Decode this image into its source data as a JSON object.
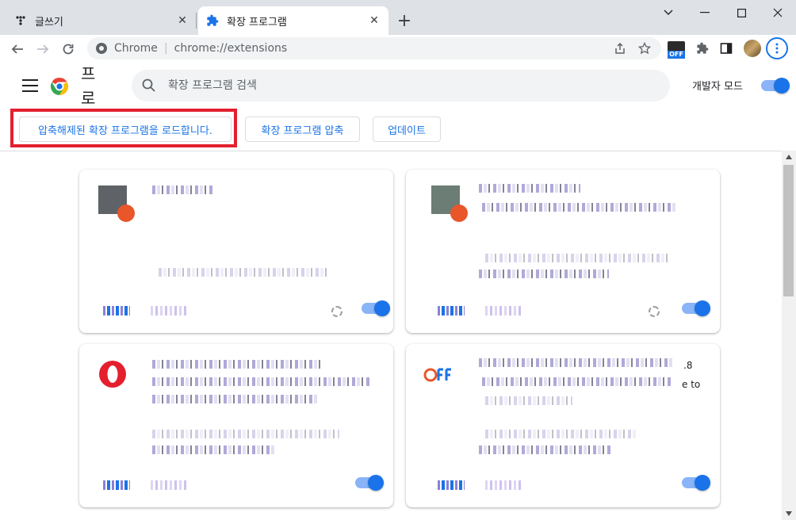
{
  "tabs": [
    {
      "label": "글쓰기",
      "icon": "writing-app-icon",
      "active": false
    },
    {
      "label": "확장 프로그램",
      "icon": "puzzle-icon",
      "active": true
    }
  ],
  "omnibox": {
    "site_label": "Chrome",
    "url": "chrome://extensions"
  },
  "extension_badge": {
    "label": "OFF"
  },
  "header": {
    "title_chars": [
      "프",
      "로"
    ],
    "search_placeholder": "확장 프로그램 검색",
    "dev_mode_label": "개발자 모드",
    "dev_mode_on": true
  },
  "actions": {
    "load_unpacked": "압축해제된 확장 프로그램을 로드합니다.",
    "pack": "확장 프로그램 압축",
    "update": "업데이트"
  },
  "cards": [
    {
      "enabled": true
    },
    {
      "enabled": true
    },
    {
      "enabled": true,
      "icon": "opera-icon"
    },
    {
      "enabled": true,
      "icon": "off-icon",
      "visible_text": [
        ".8",
        "e to"
      ]
    }
  ],
  "colors": {
    "accent": "#1a73e8",
    "highlight": "#e4202e"
  }
}
